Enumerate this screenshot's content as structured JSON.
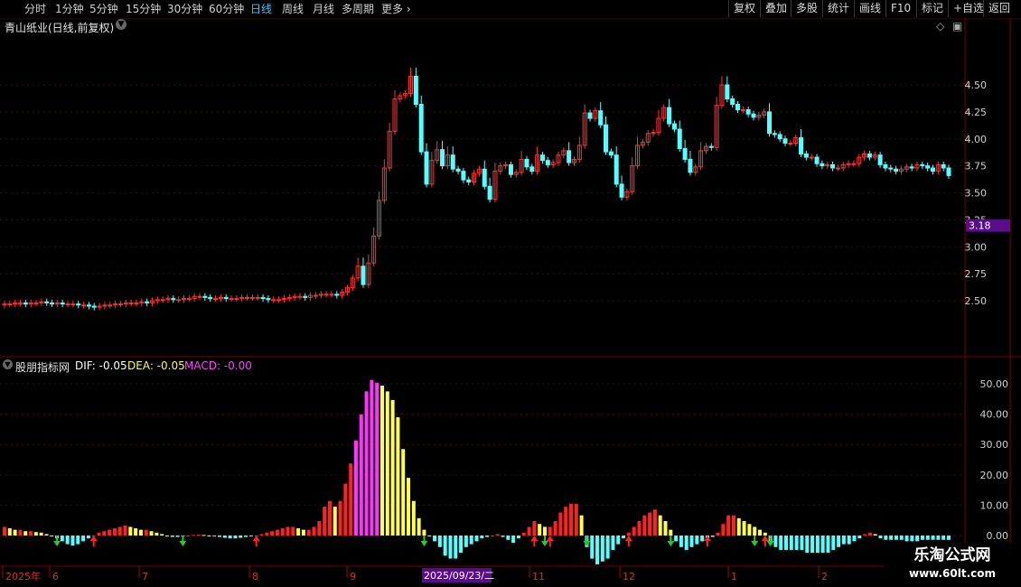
{
  "toolbar": {
    "periods": [
      "分时",
      "1分钟",
      "5分钟",
      "15分钟",
      "30分钟",
      "60分钟",
      "日线",
      "周线",
      "月线",
      "多周期",
      "更多"
    ],
    "active_period": "日线",
    "right_buttons": [
      "复权",
      "叠加",
      "多股",
      "统计",
      "画线",
      "F10",
      "标记",
      "+自选",
      "返回"
    ]
  },
  "main_panel": {
    "stock_title": "青山纸业(日线,前复权)",
    "price_axis_ticks": [
      "4.50",
      "4.25",
      "4.00",
      "3.75",
      "3.50",
      "3.25",
      "3.00",
      "2.75",
      "2.50"
    ],
    "price_marker": "3.18",
    "price_marker_color": "#5a0c8c"
  },
  "indicator_panel": {
    "name": "股朋指标网",
    "dif_label": "DIF: -0.05",
    "dea_label": "DEA: -0.05",
    "macd_label": "MACD: -0.00",
    "axis_ticks": [
      "50.00",
      "40.00",
      "30.00",
      "20.00",
      "10.00",
      "0.00"
    ]
  },
  "date_axis": {
    "labels": [
      "2025年",
      "6",
      "7",
      "8",
      "9",
      "11",
      "12",
      "1",
      "2"
    ],
    "cursor_date": "2025/09/23/二"
  },
  "watermark": {
    "line1": "乐淘公式网",
    "line2": "www.60lt.com"
  },
  "colors": {
    "up": "#ff3232",
    "down": "#54ffff",
    "active_tab": "#3cc4f0",
    "dif": "#ffffff",
    "dea": "#ffff44",
    "macd": "#ff44ff"
  },
  "chart_data": {
    "type": "candlestick",
    "price_range": [
      2.3,
      4.85
    ],
    "closes": [
      2.47,
      2.47,
      2.48,
      2.48,
      2.47,
      2.48,
      2.48,
      2.49,
      2.48,
      2.47,
      2.48,
      2.47,
      2.47,
      2.47,
      2.46,
      2.46,
      2.45,
      2.44,
      2.45,
      2.46,
      2.46,
      2.47,
      2.47,
      2.48,
      2.48,
      2.48,
      2.49,
      2.48,
      2.5,
      2.51,
      2.51,
      2.52,
      2.51,
      2.51,
      2.52,
      2.52,
      2.54,
      2.54,
      2.53,
      2.52,
      2.52,
      2.53,
      2.52,
      2.52,
      2.52,
      2.53,
      2.53,
      2.53,
      2.53,
      2.52,
      2.51,
      2.51,
      2.51,
      2.52,
      2.53,
      2.54,
      2.54,
      2.53,
      2.55,
      2.55,
      2.56,
      2.56,
      2.56,
      2.55,
      2.58,
      2.62,
      2.71,
      2.82,
      2.65,
      2.85,
      3.1,
      3.43,
      3.73,
      4.07,
      4.37,
      4.4,
      4.42,
      4.58,
      4.32,
      3.88,
      3.58,
      3.8,
      3.9,
      3.75,
      3.85,
      3.72,
      3.7,
      3.62,
      3.6,
      3.68,
      3.72,
      3.56,
      3.44,
      3.7,
      3.75,
      3.76,
      3.67,
      3.69,
      3.81,
      3.74,
      3.7,
      3.85,
      3.8,
      3.76,
      3.78,
      3.85,
      3.89,
      3.78,
      3.81,
      3.94,
      4.24,
      4.19,
      4.26,
      4.13,
      3.88,
      3.85,
      3.58,
      3.46,
      3.51,
      3.75,
      3.94,
      3.97,
      4.05,
      4.06,
      4.19,
      4.29,
      4.14,
      4.09,
      3.91,
      3.81,
      3.69,
      3.74,
      3.89,
      3.93,
      3.92,
      4.31,
      4.5,
      4.37,
      4.32,
      4.27,
      4.27,
      4.23,
      4.2,
      4.22,
      4.25,
      4.05,
      4.04,
      4.0,
      3.96,
      3.96,
      4.01,
      3.86,
      3.83,
      3.83,
      3.77,
      3.75,
      3.76,
      3.73,
      3.73,
      3.76,
      3.77,
      3.77,
      3.83,
      3.86,
      3.83,
      3.85,
      3.76,
      3.73,
      3.72,
      3.7,
      3.72,
      3.74,
      3.73,
      3.76,
      3.75,
      3.73,
      3.7,
      3.76,
      3.73,
      3.66
    ],
    "macd_hist": [
      3,
      2.5,
      2,
      2,
      1.5,
      1.5,
      1.2,
      1,
      0.5,
      0,
      -1,
      -2,
      -3,
      -3.5,
      -3,
      -2,
      -1,
      0,
      1,
      1.5,
      2,
      2.5,
      3,
      3.5,
      3,
      2.5,
      2,
      2,
      1.5,
      1,
      0.5,
      0,
      -0.5,
      -0.5,
      -0.3,
      0,
      0.2,
      0.3,
      0.2,
      0,
      -0.3,
      -0.5,
      -0.8,
      -1,
      -1,
      -0.8,
      -0.5,
      -0.2,
      0,
      0.5,
      1,
      1.5,
      2,
      2.5,
      3,
      3,
      2.5,
      2,
      2,
      3,
      5,
      10,
      12,
      10,
      12,
      18,
      25,
      33,
      42,
      50,
      54,
      53,
      52,
      50,
      47,
      41,
      30,
      20,
      12,
      6,
      2,
      0,
      -2,
      -4,
      -7,
      -8,
      -8,
      -6,
      -4,
      -3,
      -2,
      -1,
      -0.5,
      0,
      0.5,
      -0.5,
      -1.5,
      -2.5,
      -1,
      1,
      3,
      5,
      4,
      3,
      3,
      5,
      8,
      10,
      11,
      11,
      7,
      -4,
      -8,
      -10,
      -9,
      -8,
      -5,
      -3,
      -1,
      1,
      3,
      5,
      7,
      8,
      9,
      7,
      5,
      2,
      -2,
      -4,
      -5,
      -4,
      -3,
      -2,
      -1,
      -0.5,
      1,
      4,
      7,
      7,
      6,
      5,
      4,
      3,
      2,
      1,
      -3,
      -4,
      -5,
      -5,
      -5,
      -5,
      -5,
      -6,
      -6,
      -6,
      -6,
      -6,
      -5,
      -4,
      -3,
      -3,
      -2,
      -1,
      0.5,
      1,
      0.5,
      -1,
      -1.5,
      -1.5,
      -1.5,
      -1.5,
      -2,
      -2,
      -2,
      -1.5,
      -1.5,
      -1.5,
      -1.5,
      -1.5,
      -1.5
    ],
    "signals": [
      {
        "i": 10,
        "dir": "down"
      },
      {
        "i": 17,
        "dir": "up"
      },
      {
        "i": 34,
        "dir": "down"
      },
      {
        "i": 48,
        "dir": "up"
      },
      {
        "i": 80,
        "dir": "down"
      },
      {
        "i": 101,
        "dir": "up"
      },
      {
        "i": 103,
        "dir": "down"
      },
      {
        "i": 104,
        "dir": "up"
      },
      {
        "i": 111,
        "dir": "down"
      },
      {
        "i": 119,
        "dir": "up"
      },
      {
        "i": 127,
        "dir": "down"
      },
      {
        "i": 134,
        "dir": "up"
      },
      {
        "i": 143,
        "dir": "down"
      },
      {
        "i": 145,
        "dir": "up"
      },
      {
        "i": 146,
        "dir": "down"
      }
    ]
  }
}
